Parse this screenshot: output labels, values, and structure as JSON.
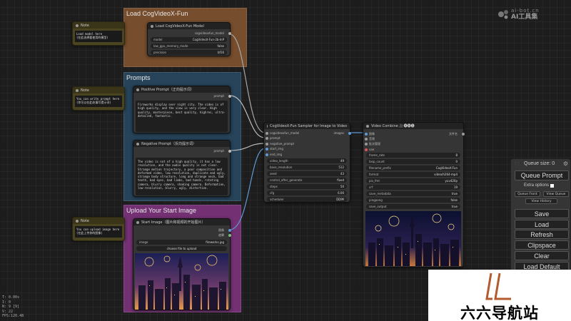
{
  "watermark": {
    "site": "ai-bot.cn",
    "name": "AI工具集"
  },
  "brand": {
    "name": "六六导航站"
  },
  "groups": {
    "load_model": "Load CogVideoX-Fun",
    "prompts": "Prompts",
    "start_image": "Upload Your Start Image"
  },
  "notes": [
    {
      "title": "Note",
      "text": "Load model here\n(在此选择要使用的模型)"
    },
    {
      "title": "Note",
      "text": "You can write prompt here\n(你可以在此处填写提示词)"
    },
    {
      "title": "Note",
      "text": "You can upload image here\n(在此上传你的图像)"
    }
  ],
  "load_model_node": {
    "title": "Load CogVideoX-Fun Model",
    "output": "cogvideoxfun_model",
    "widgets": [
      {
        "label": "model",
        "value": "CogVideoX-Fun-2b-InP"
      },
      {
        "label": "low_gpu_memory_mode",
        "value": "false"
      },
      {
        "label": "precision",
        "value": "bf16"
      }
    ]
  },
  "positive_prompt": {
    "title": "Positive Prompt（正向提示词）",
    "output": "prompt",
    "text": "Fireworks display over night city. The video is of high quality, and the view is very clear. High quality, masterpiece, best quality, highres, ultra-detailed, fantastic."
  },
  "negative_prompt": {
    "title": "Negative Prompt（反向提示词）",
    "output": "prompt",
    "text": "The video is not of a high quality, it has a low resolution, and the audio quality is not clear. Strange motion trajectory, a poor composition and deformed video, low resolution, duplicate and ugly, strange body structure, long and strange neck, bad teeth, bad eyes, bad limbs, bad hands, rotating camera, blurry camera, shaking camera. Deformation, low-resolution, blurry, ugly, distortion."
  },
  "start_image_node": {
    "title": "Start Image（图片和视频的开始图片）",
    "outputs": [
      "图像",
      "遮罩"
    ],
    "image_label": "image",
    "image_value": "fireworks.jpg",
    "upload_label": "choose file to upload"
  },
  "sampler": {
    "title": "CogVideoX-Fun Sampler for Image to Video",
    "inputs": [
      "cogvideoxfun_model",
      "prompt",
      "negative_prompt",
      "start_img",
      "end_img"
    ],
    "output": "images",
    "widgets": [
      {
        "label": "video_length",
        "value": "49"
      },
      {
        "label": "base_resolution",
        "value": "512"
      },
      {
        "label": "seed",
        "value": "43"
      },
      {
        "label": "control_after_generate",
        "value": "fixed"
      },
      {
        "label": "steps",
        "value": "50"
      },
      {
        "label": "cfg",
        "value": "6.00"
      },
      {
        "label": "scheduler",
        "value": "DDIM"
      }
    ]
  },
  "video_combine": {
    "title": "Video Combine 🎥🅥🅗🅢",
    "inputs": [
      "图像",
      "音频",
      "批次管理",
      "vae"
    ],
    "output": "文件名",
    "widgets": [
      {
        "label": "frame_rate",
        "value": "8"
      },
      {
        "label": "loop_count",
        "value": "0"
      },
      {
        "label": "filename_prefix",
        "value": "CogVideoX-Fun"
      },
      {
        "label": "format",
        "value": "video/h264-mp4"
      },
      {
        "label": "pix_fmt",
        "value": "yuv420p"
      },
      {
        "label": "crf",
        "value": "19"
      },
      {
        "label": "save_metadata",
        "value": "true"
      },
      {
        "label": "pingpong",
        "value": "false"
      },
      {
        "label": "save_output",
        "value": "true"
      }
    ]
  },
  "queue": {
    "size_label": "Queue size: 0",
    "queue_prompt": "Queue Prompt",
    "extra_options": "Extra options",
    "queue_front": "Queue Front",
    "view_queue": "View Queue",
    "view_history": "View History",
    "save": "Save",
    "load": "Load",
    "refresh": "Refresh",
    "clipspace": "Clipspace",
    "clear": "Clear",
    "load_default": "Load Default"
  },
  "stats": [
    "T: 0.00s",
    "I: 0",
    "N: 9 [9]",
    "V: 22",
    "FPS:120.48"
  ]
}
